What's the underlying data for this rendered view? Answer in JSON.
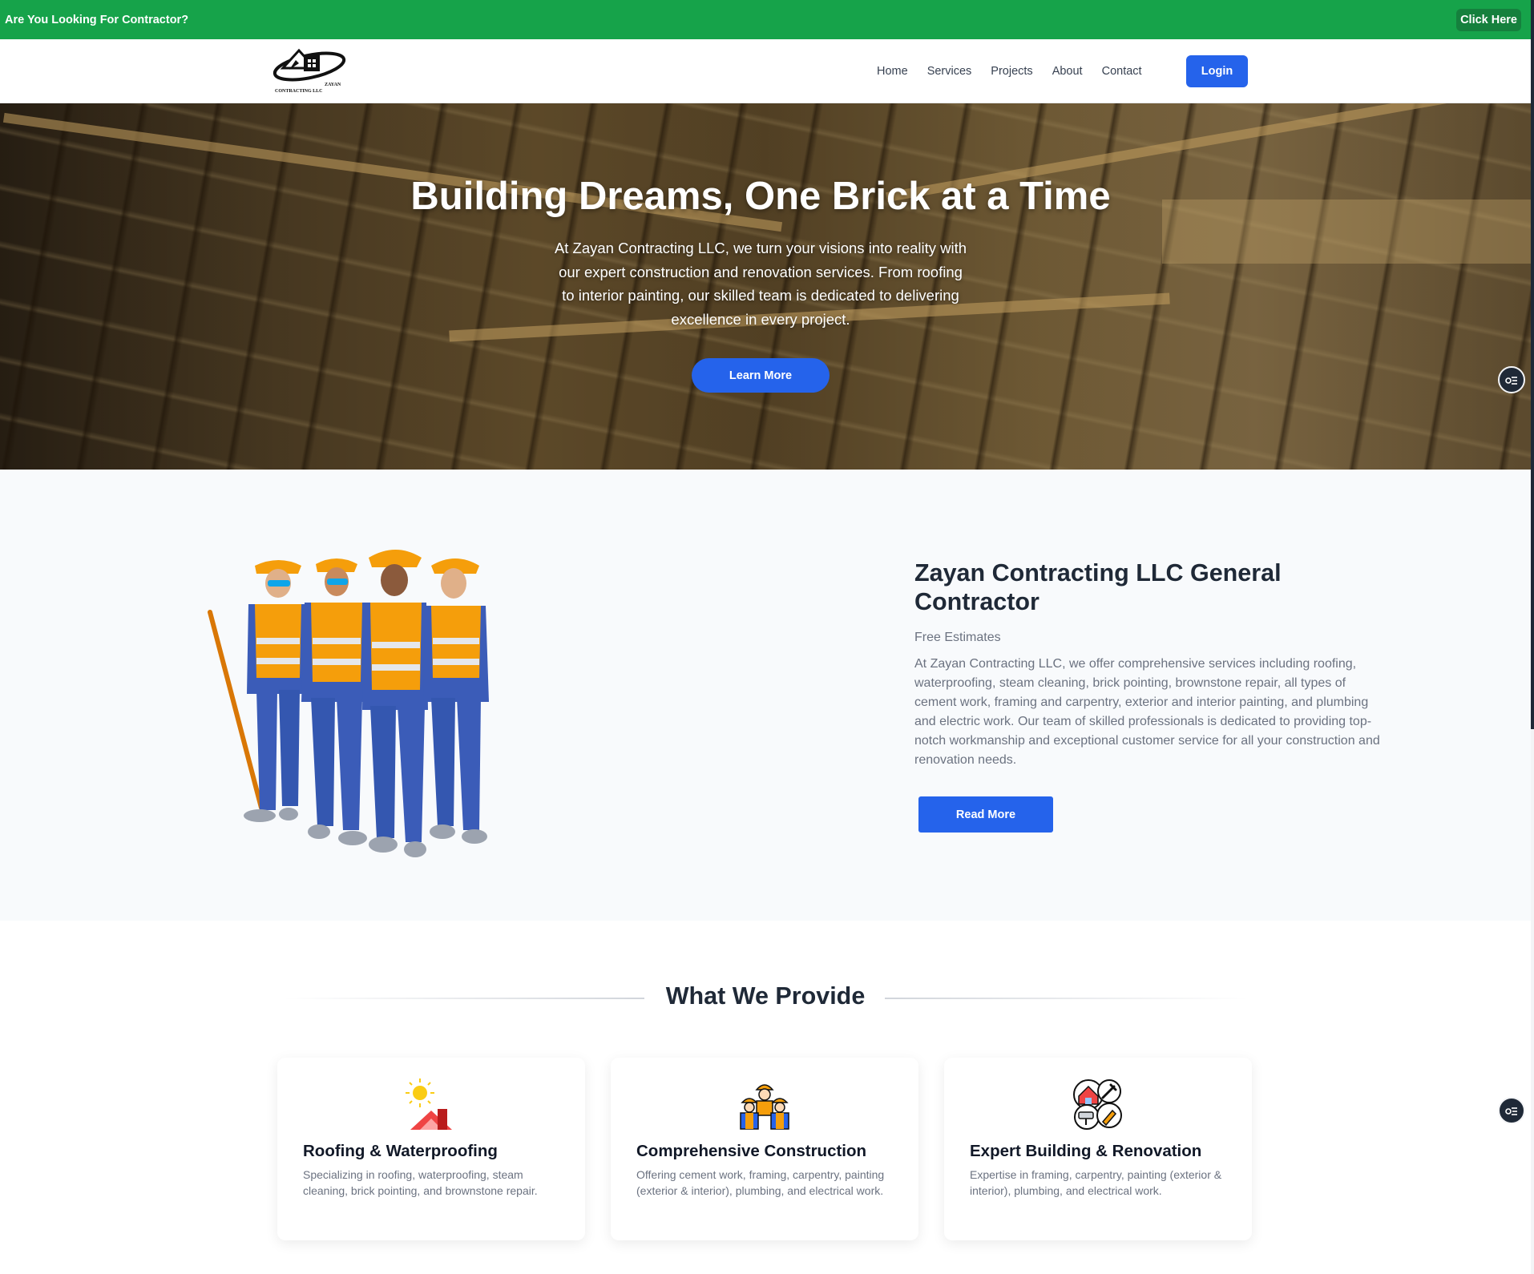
{
  "promo": {
    "text": "Are You Looking For Contractor?",
    "button": "Click Here"
  },
  "header": {
    "logo_text_line1": "ZAYAN",
    "logo_text_line2": "CONTRACTING LLC",
    "nav": [
      "Home",
      "Services",
      "Projects",
      "About",
      "Contact"
    ],
    "login": "Login"
  },
  "hero": {
    "title": "Building Dreams, One Brick at a Time",
    "text": "At Zayan Contracting LLC, we turn your visions into reality with our expert construction and renovation services. From roofing to interior painting, our skilled team is dedicated to delivering excellence in every project.",
    "button": "Learn More"
  },
  "about": {
    "title": "Zayan Contracting LLC General Contractor",
    "subtitle": "Free Estimates",
    "text": "At Zayan Contracting LLC, we offer comprehensive services including roofing, waterproofing, steam cleaning, brick pointing, brownstone repair, all types of cement work, framing and carpentry, exterior and interior painting, and plumbing and electric work. Our team of skilled professionals  is dedicated to providing top-notch workmanship and exceptional customer  service for all your construction and renovation needs.",
    "button": "Read More"
  },
  "provide": {
    "title": "What We Provide",
    "cards": [
      {
        "title": "Roofing & Waterproofing",
        "text": "Specializing in roofing, waterproofing, steam cleaning, brick pointing, and brownstone repair.",
        "icon": "roof-sun-icon"
      },
      {
        "title": "Comprehensive Construction",
        "text": "Offering cement work, framing, carpentry, painting (exterior & interior), plumbing, and electrical work.",
        "icon": "workers-team-icon"
      },
      {
        "title": "Expert Building & Renovation",
        "text": "Expertise in framing, carpentry, painting (exterior & interior), plumbing, and electrical work.",
        "icon": "renovation-tools-icon"
      }
    ]
  },
  "colors": {
    "promo": "#16a34a",
    "primary": "#2563eb",
    "text_dark": "#1f2937",
    "text_muted": "#6b7280"
  }
}
